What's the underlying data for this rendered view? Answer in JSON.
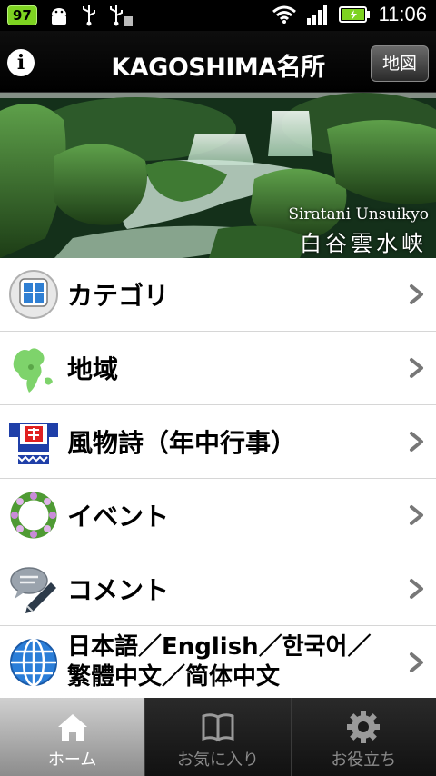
{
  "status_bar": {
    "battery_badge": "97",
    "time": "11:06",
    "icons": [
      "android-icon",
      "usb-icon",
      "usb-icon",
      "wifi-icon",
      "signal-icon",
      "battery-icon"
    ]
  },
  "header": {
    "info_label": "i",
    "title": "KAGOSHIMA名所",
    "map_button": "地図"
  },
  "banner": {
    "caption_en": "Siratani Unsuikyo",
    "caption_jp": "白谷雲水峡"
  },
  "menu": {
    "items": [
      {
        "label": "カテゴリ",
        "icon": "category-icon"
      },
      {
        "label": "地域",
        "icon": "region-map-icon"
      },
      {
        "label": "風物詩（年中行事）",
        "icon": "festival-happi-icon"
      },
      {
        "label": "イベント",
        "icon": "flower-wreath-icon"
      },
      {
        "label": "コメント",
        "icon": "comment-icon"
      },
      {
        "label_line1": "日本語／English／한국어／",
        "label_line2": "繁體中文／简体中文",
        "icon": "globe-icon"
      }
    ]
  },
  "tabs": [
    {
      "label": "ホーム",
      "icon": "home-icon",
      "active": true
    },
    {
      "label": "お気に入り",
      "icon": "book-icon",
      "active": false
    },
    {
      "label": "お役立ち",
      "icon": "gear-icon",
      "active": false
    }
  ],
  "colors": {
    "accent_green": "#7ed321",
    "list_background": "#ffffff",
    "tab_active": "#b8b8b8"
  }
}
